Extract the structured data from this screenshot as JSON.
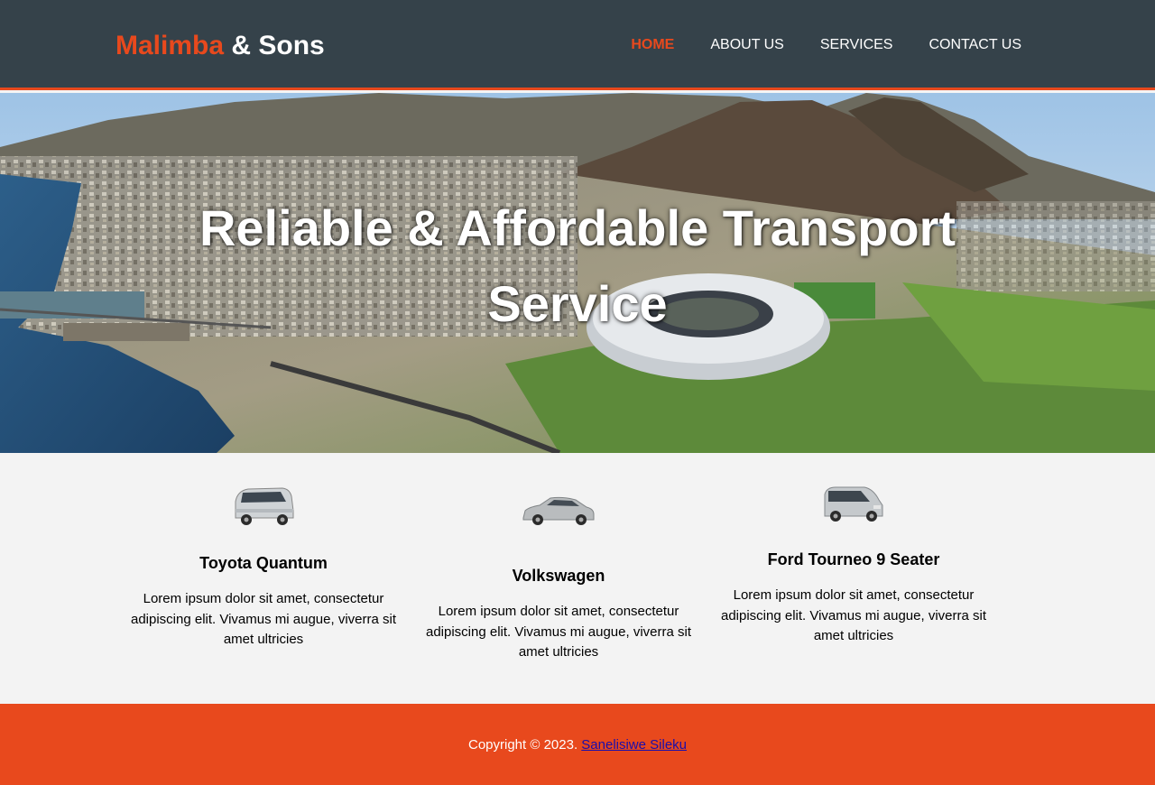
{
  "header": {
    "brand_highlight": "Malimba",
    "brand_rest": " & Sons",
    "nav": [
      {
        "label": "HOME",
        "active": true
      },
      {
        "label": "ABOUT US",
        "active": false
      },
      {
        "label": "SERVICES",
        "active": false
      },
      {
        "label": "CONTACT US",
        "active": false
      }
    ]
  },
  "hero": {
    "title": "Reliable & Affordable Transport Service",
    "image": "aerial-city-stadium-photo"
  },
  "services": [
    {
      "name": "Toyota Quantum",
      "text": "Lorem ipsum dolor sit amet, consectetur adipiscing elit. Vivamus mi augue, viverra sit amet ultricies",
      "icon": "minibus-icon"
    },
    {
      "name": "Volkswagen",
      "text": "Lorem ipsum dolor sit amet, consectetur adipiscing elit. Vivamus mi augue, viverra sit amet ultricies",
      "icon": "hatchback-car-icon"
    },
    {
      "name": "Ford Tourneo 9 Seater",
      "text": "Lorem ipsum dolor sit amet, consectetur adipiscing elit. Vivamus mi augue, viverra sit amet ultricies",
      "icon": "van-icon"
    }
  ],
  "footer": {
    "copyright": "Copyright © 2023.",
    "author_link": "Sanelisiwe Sileku"
  },
  "colors": {
    "header_bg": "#35424a",
    "accent": "#e8491d",
    "body_bg": "#f3f3f3"
  }
}
